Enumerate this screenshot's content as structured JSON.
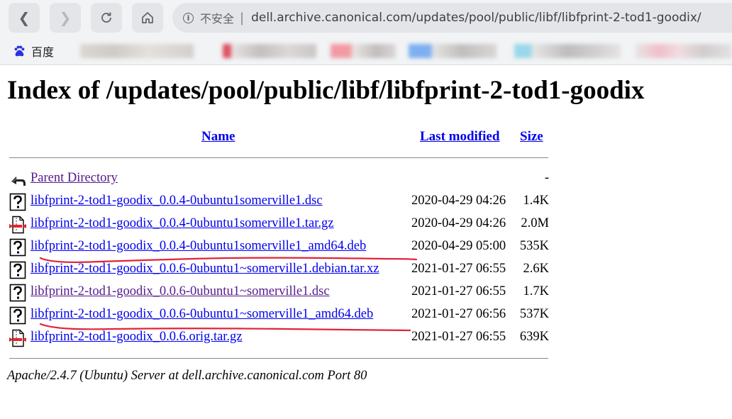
{
  "browser": {
    "security_label": "不安全",
    "separator": "|",
    "url": "dell.archive.canonical.com/updates/pool/public/libf/libfprint-2-tod1-goodix/",
    "bookmarks": [
      {
        "label": "百度",
        "icon": "baidu-paw-icon"
      }
    ]
  },
  "page": {
    "title": "Index of /updates/pool/public/libf/libfprint-2-tod1-goodix",
    "columns": {
      "name": "Name",
      "modified": "Last modified",
      "size": "Size"
    },
    "rows": [
      {
        "name": "Parent Directory",
        "modified": "",
        "size": "-",
        "icon": "back-arrow-icon",
        "visited": true
      },
      {
        "name": "libfprint-2-tod1-goodix_0.0.4-0ubuntu1somerville1.dsc",
        "modified": "2020-04-29 04:26",
        "size": "1.4K",
        "icon": "unknown-file-icon",
        "visited": false
      },
      {
        "name": "libfprint-2-tod1-goodix_0.0.4-0ubuntu1somerville1.tar.gz",
        "modified": "2020-04-29 04:26",
        "size": "2.0M",
        "icon": "compressed-file-icon",
        "visited": false
      },
      {
        "name": "libfprint-2-tod1-goodix_0.0.4-0ubuntu1somerville1_amd64.deb",
        "modified": "2020-04-29 05:00",
        "size": "535K",
        "icon": "unknown-file-icon",
        "visited": false,
        "annotated": true
      },
      {
        "name": "libfprint-2-tod1-goodix_0.0.6-0ubuntu1~somerville1.debian.tar.xz",
        "modified": "2021-01-27 06:55",
        "size": "2.6K",
        "icon": "unknown-file-icon",
        "visited": false
      },
      {
        "name": "libfprint-2-tod1-goodix_0.0.6-0ubuntu1~somerville1.dsc",
        "modified": "2021-01-27 06:55",
        "size": "1.7K",
        "icon": "unknown-file-icon",
        "visited": true
      },
      {
        "name": "libfprint-2-tod1-goodix_0.0.6-0ubuntu1~somerville1_amd64.deb",
        "modified": "2021-01-27 06:56",
        "size": "537K",
        "icon": "unknown-file-icon",
        "visited": false,
        "annotated": true
      },
      {
        "name": "libfprint-2-tod1-goodix_0.0.6.orig.tar.gz",
        "modified": "2021-01-27 06:55",
        "size": "639K",
        "icon": "compressed-file-icon",
        "visited": false
      }
    ],
    "server_signature": "Apache/2.4.7 (Ubuntu) Server at dell.archive.canonical.com Port 80"
  },
  "colors": {
    "link": "#0000ee",
    "visited": "#551a8b",
    "annotation": "#e0243a"
  }
}
